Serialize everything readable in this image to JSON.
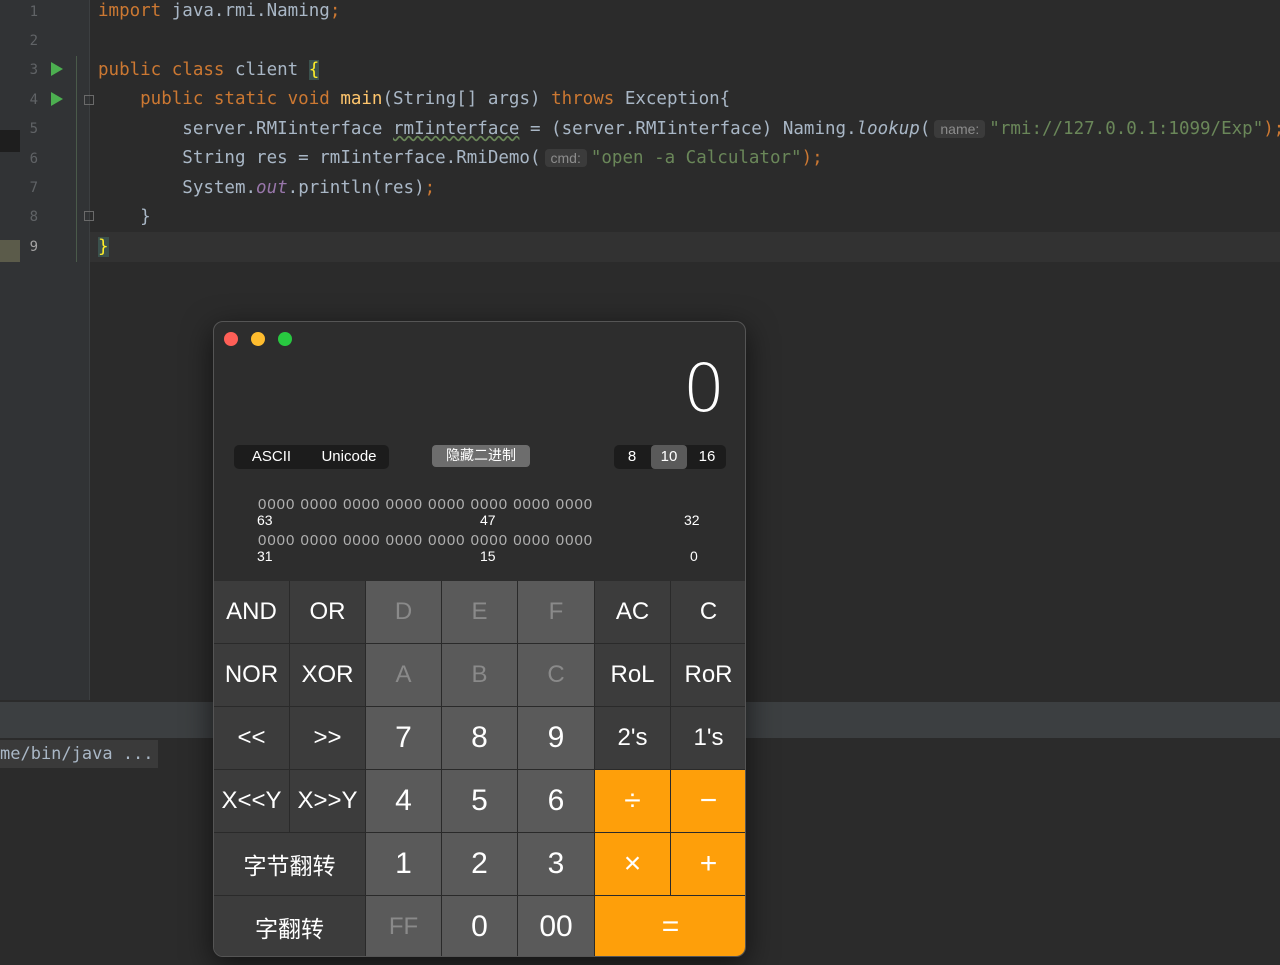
{
  "editor": {
    "line_numbers": [
      "1",
      "2",
      "3",
      "4",
      "5",
      "6",
      "7",
      "8",
      "9"
    ],
    "lines": [
      {
        "segments": [
          {
            "t": "import ",
            "c": "kw"
          },
          {
            "t": "java.rmi.Naming"
          },
          {
            "t": ";",
            "c": "kw"
          }
        ]
      },
      {
        "segments": []
      },
      {
        "segments": [
          {
            "t": "public class ",
            "c": "kw"
          },
          {
            "t": "client "
          },
          {
            "t": "{",
            "c": "brace"
          }
        ]
      },
      {
        "segments": [
          {
            "t": "    public static void ",
            "c": "kw"
          },
          {
            "t": "main",
            "c": "fn"
          },
          {
            "t": "(String[] args) "
          },
          {
            "t": "throws ",
            "c": "kw"
          },
          {
            "t": "Exception{"
          }
        ]
      },
      {
        "segments": [
          {
            "t": "        server.RMIinterface "
          },
          {
            "t": "rmIinterface",
            "c": "und"
          },
          {
            "t": " = (server.RMIinterface) Naming."
          },
          {
            "t": "lookup",
            "c": "itw"
          },
          {
            "t": "("
          },
          {
            "t": "name:",
            "c": "hint"
          },
          {
            "t": "\"rmi://127.0.0.1:1099/Exp\"",
            "c": "str"
          },
          {
            "t": ");",
            "c": "kw"
          }
        ]
      },
      {
        "segments": [
          {
            "t": "        String res = rmIinterface.RmiDemo("
          },
          {
            "t": "cmd:",
            "c": "hint"
          },
          {
            "t": "\"open -a Calculator\"",
            "c": "str"
          },
          {
            "t": ");",
            "c": "kw"
          }
        ]
      },
      {
        "segments": [
          {
            "t": "        System."
          },
          {
            "t": "out",
            "c": "it"
          },
          {
            "t": ".println(res)"
          },
          {
            "t": ";",
            "c": "kw"
          }
        ]
      },
      {
        "segments": [
          {
            "t": "    }"
          }
        ]
      },
      {
        "segments": [
          {
            "t": "}",
            "c": "brace"
          }
        ]
      }
    ]
  },
  "console": {
    "text": "me/bin/java ..."
  },
  "calculator": {
    "display_value": "0",
    "encoding_tabs": [
      "ASCII",
      "Unicode"
    ],
    "hide_binary_label": "隐藏二进制",
    "base_tabs": [
      "8",
      "10",
      "16"
    ],
    "selected_base": "10",
    "binary_row1": "0000 0000 0000 0000 0000 0000 0000 0000",
    "binary_row2": "0000 0000 0000 0000 0000 0000 0000 0000",
    "bit_labels_row1": [
      "63",
      "47",
      "32"
    ],
    "bit_labels_row2": [
      "31",
      "15",
      "0"
    ],
    "keys": [
      [
        "AND",
        "OR",
        "D",
        "E",
        "F",
        "AC",
        "C"
      ],
      [
        "NOR",
        "XOR",
        "A",
        "B",
        "C",
        "RoL",
        "RoR"
      ],
      [
        "<<",
        ">>",
        "7",
        "8",
        "9",
        "2's",
        "1's"
      ],
      [
        "X<<Y",
        "X>>Y",
        "4",
        "5",
        "6",
        "÷",
        "−"
      ],
      [
        "字节翻转",
        "1",
        "2",
        "3",
        "×",
        "+"
      ],
      [
        "字翻转",
        "FF",
        "0",
        "00",
        "="
      ]
    ],
    "colors": {
      "operator": "#fe9f0a",
      "function": "#3c3c3c",
      "digit": "#5a5a5a",
      "close": "#fe5f57",
      "minimize": "#febc2e",
      "zoom": "#28c840"
    }
  }
}
